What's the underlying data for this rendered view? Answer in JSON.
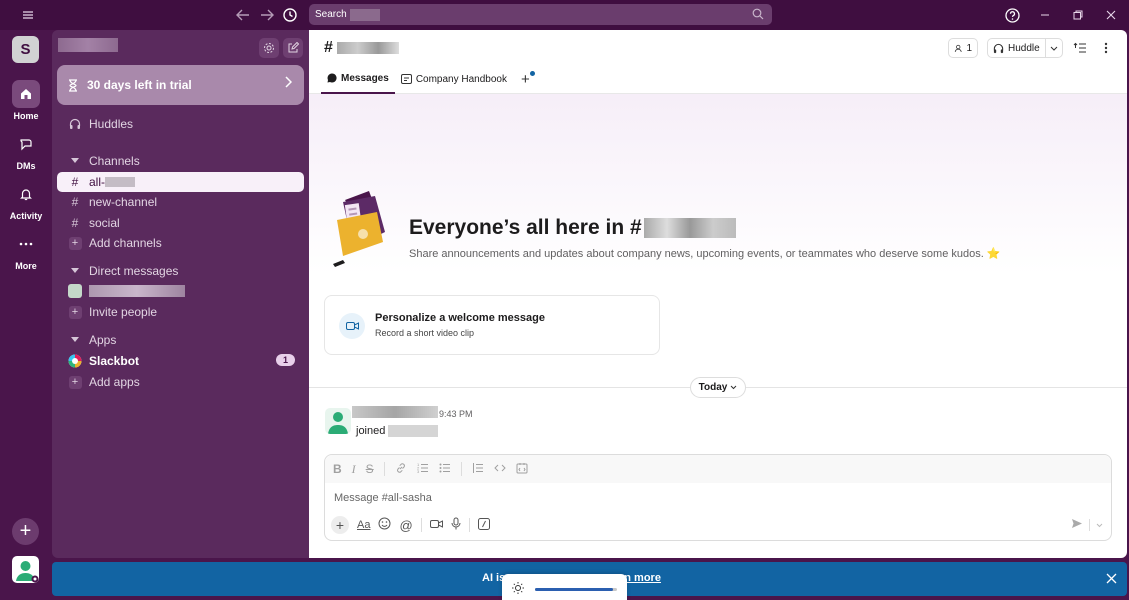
{
  "titlebar": {
    "search_placeholder": "Search"
  },
  "rail": {
    "workspace_initial": "S",
    "items": [
      {
        "label": "Home"
      },
      {
        "label": "DMs"
      },
      {
        "label": "Activity"
      },
      {
        "label": "More"
      }
    ]
  },
  "sidebar": {
    "trial_label": "30 days left in trial",
    "huddles_label": "Huddles",
    "channels_header": "Channels",
    "channels": [
      {
        "label": "all-"
      },
      {
        "label": "new-channel"
      },
      {
        "label": "social"
      }
    ],
    "add_channels_label": "Add channels",
    "dms_header": "Direct messages",
    "invite_label": "Invite people",
    "apps_header": "Apps",
    "slackbot_label": "Slackbot",
    "slackbot_badge": "1",
    "add_apps_label": "Add apps"
  },
  "channel": {
    "hash": "#",
    "member_count": "1",
    "huddle_label": "Huddle",
    "tabs": [
      {
        "label": "Messages"
      },
      {
        "label": "Company Handbook"
      }
    ],
    "hero_title": "Everyone’s all here in #",
    "hero_subtitle": "Share announcements and updates about company news, upcoming events, or teammates who deserve some kudos. ⭐",
    "welcome_title": "Personalize a welcome message",
    "welcome_subtitle": "Record a short video clip",
    "date_divider": "Today",
    "message_time": "9:43 PM",
    "message_text": "joined",
    "composer_placeholder": "Message #all-sasha"
  },
  "banner": {
    "text_start": "AI is",
    "text_link": "rn more"
  },
  "brightness": {
    "level": 0.95
  },
  "colors": {
    "aubergine": "#4a154b",
    "sidebar": "#5a2a5d",
    "banner_blue": "#1264a3"
  }
}
